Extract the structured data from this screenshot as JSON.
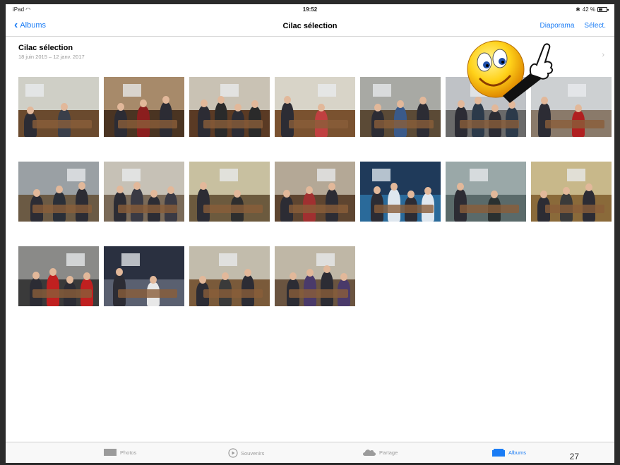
{
  "status": {
    "device": "iPad",
    "time": "19:52",
    "battery": "42 %"
  },
  "nav": {
    "back_label": "Albums",
    "title": "Cilac sélection",
    "slideshow_label": "Diaporama",
    "select_label": "Sélect."
  },
  "album": {
    "title": "Cilac sélection",
    "date_range": "18 juin 2015 – 12 janv. 2017"
  },
  "photos_count": 18,
  "tabs": [
    {
      "label": "Photos",
      "icon": "photos-icon",
      "active": false
    },
    {
      "label": "Souvenirs",
      "icon": "memories-icon",
      "active": false
    },
    {
      "label": "Partage",
      "icon": "cloud-icon",
      "active": false
    },
    {
      "label": "Albums",
      "icon": "albums-icon",
      "active": true
    }
  ],
  "page_number": "27",
  "colors": {
    "accent": "#1a7cf5",
    "tab_inactive": "#9b9b9b"
  },
  "mascot": {
    "icon": "smiley-pointing-icon"
  }
}
